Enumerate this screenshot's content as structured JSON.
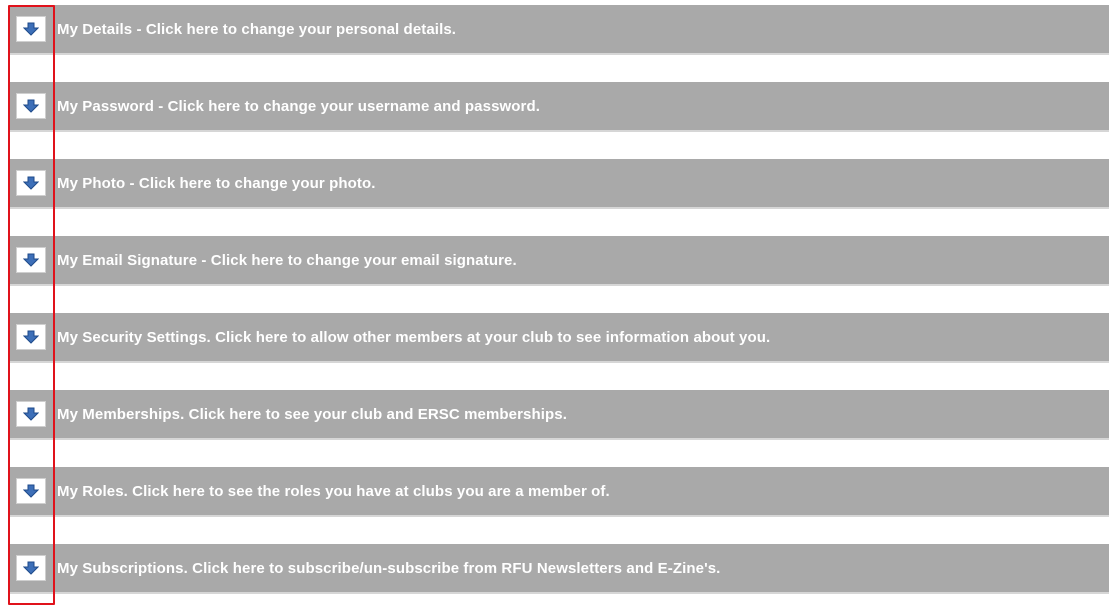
{
  "accordion": {
    "toggle_icon": "arrow-down-icon",
    "colors": {
      "row_background": "#a9a9a9",
      "row_text": "#ffffff",
      "toggle_arrow": "#3d6fb8",
      "highlight": "#e0121b"
    },
    "items": [
      {
        "label": "My Details - Click here to change your personal details."
      },
      {
        "label": "My Password - Click here to change your username and password."
      },
      {
        "label": "My Photo - Click here to change your photo."
      },
      {
        "label": "My Email Signature - Click here to change your email signature."
      },
      {
        "label": "My Security Settings. Click here to allow other members at your club to see information about you."
      },
      {
        "label": "My Memberships. Click here to see your club and ERSC memberships."
      },
      {
        "label": "My Roles. Click here to see the roles you have at clubs you are a member of."
      },
      {
        "label": "My Subscriptions. Click here to subscribe/un-subscribe from RFU Newsletters and E-Zine's."
      }
    ]
  }
}
